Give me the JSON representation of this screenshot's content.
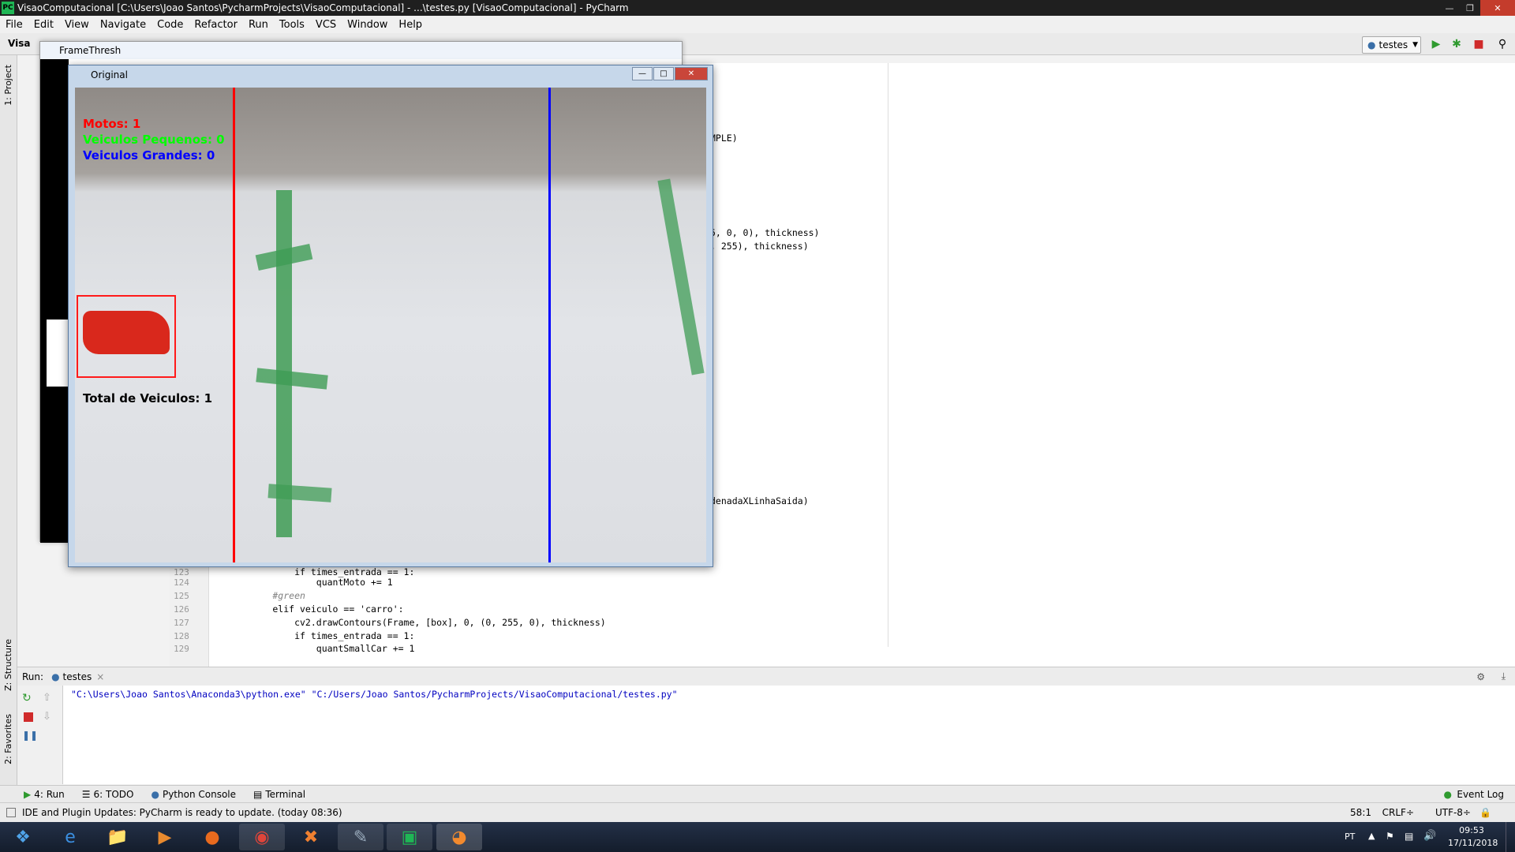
{
  "window": {
    "title": "VisaoComputacional [C:\\Users\\Joao Santos\\PycharmProjects\\VisaoComputacional] - ...\\testes.py [VisaoComputacional] - PyCharm"
  },
  "menu": [
    "File",
    "Edit",
    "View",
    "Navigate",
    "Code",
    "Refactor",
    "Run",
    "Tools",
    "VCS",
    "Window",
    "Help"
  ],
  "toolbar": {
    "project_crumb": "Visa",
    "run_config": "testes"
  },
  "sidebar": {
    "project_tab": "1: Project",
    "structure_tab": "Z: Structure",
    "favorites_tab": "2: Favorites"
  },
  "frame_thresh": {
    "title": "FrameThresh"
  },
  "original": {
    "title": "Original",
    "motos": "Motos: 1",
    "pequenos": "Veiculos Pequenos: 0",
    "grandes": "Veiculos Grandes: 0",
    "total": "Total de Veiculos: 1"
  },
  "editor": {
    "visible_fragments": [
      "MPLE)",
      "5, 0, 0), thickness)",
      ", 255), thickness)",
      "denadaXLinhaSaida)"
    ],
    "lines": [
      {
        "num": "123",
        "code": "            if times_entrada == 1:"
      },
      {
        "num": "124",
        "code": "                quantMoto += 1"
      },
      {
        "num": "125",
        "code": "        #green"
      },
      {
        "num": "126",
        "code": "        elif veiculo == 'carro':"
      },
      {
        "num": "127",
        "code": "            cv2.drawContours(Frame, [box], 0, (0, 255, 0), thickness)"
      },
      {
        "num": "128",
        "code": "            if times_entrada == 1:"
      },
      {
        "num": "129",
        "code": "                quantSmallCar += 1"
      }
    ]
  },
  "run_panel": {
    "label": "Run:",
    "tab": "testes",
    "output": "\"C:\\Users\\Joao Santos\\Anaconda3\\python.exe\" \"C:/Users/Joao Santos/PycharmProjects/VisaoComputacional/testes.py\""
  },
  "tool_tabs": {
    "run": "4: Run",
    "todo": "6: TODO",
    "python_console": "Python Console",
    "terminal": "Terminal",
    "event_log": "Event Log"
  },
  "status": {
    "message": "IDE and Plugin Updates: PyCharm is ready to update. (today 08:36)",
    "position": "58:1",
    "line_sep": "CRLF÷",
    "encoding": "UTF-8÷"
  },
  "taskbar": {
    "lang": "PT",
    "time": "09:53",
    "date": "17/11/2018"
  },
  "colors": {
    "accent_red": "#ff0000",
    "accent_green": "#00ff00",
    "accent_blue": "#0000ff"
  }
}
